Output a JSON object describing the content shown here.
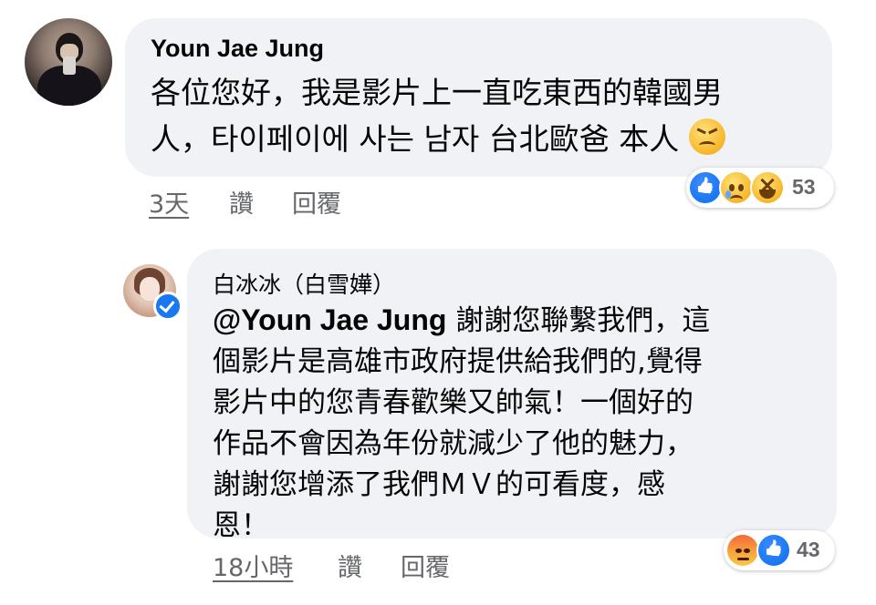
{
  "comments": [
    {
      "author": "Youn Jae Jung",
      "text_line1": "各位您好，我是影片上一直吃東西的韓國男",
      "text_line2": "人，타이페이에 사는 남자 台北歐爸 本人",
      "inline_emoji": "persevering-face-icon",
      "time": "3天",
      "like_label": "讚",
      "reply_label": "回覆",
      "reactions": [
        "like-icon",
        "sad-icon",
        "haha-icon"
      ],
      "reaction_count": "53"
    },
    {
      "author": "白冰冰（白雪嬅）",
      "verified": true,
      "mention": "@Youn Jae Jung",
      "text_after_mention": " 謝謝您聯繫我們，這",
      "text_lines": [
        "個影片是高雄市政府提供給我們的,覺得",
        "影片中的您青春歡樂又帥氣！一個好的",
        "作品不會因為年份就減少了他的魅力，",
        "謝謝您增添了我們ＭＶ的可看度，感",
        "恩！"
      ],
      "time": "18小時",
      "like_label": "讚",
      "reply_label": "回覆",
      "reactions": [
        "angry-icon",
        "like-icon"
      ],
      "reaction_count": "43"
    }
  ],
  "colors": {
    "bubble": "#f0f2f5",
    "text": "#050505",
    "meta": "#65676b",
    "facebook_blue": "#1877f2"
  }
}
